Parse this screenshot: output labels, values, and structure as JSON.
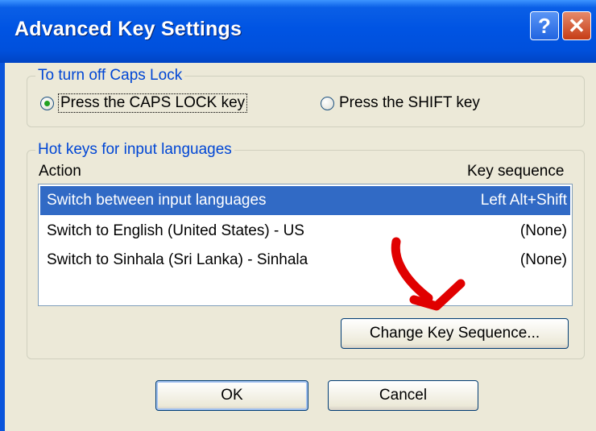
{
  "window": {
    "title": "Advanced Key Settings",
    "help_icon": "?",
    "close_icon": "✕"
  },
  "caps_lock": {
    "legend": "To turn off Caps Lock",
    "options": [
      {
        "label": "Press the CAPS LOCK key",
        "selected": true
      },
      {
        "label": "Press the SHIFT key",
        "selected": false
      }
    ]
  },
  "hotkeys": {
    "legend": "Hot keys for input languages",
    "columns": {
      "action": "Action",
      "key_sequence": "Key sequence"
    },
    "rows": [
      {
        "action": "Switch between input languages",
        "keys": "Left Alt+Shift",
        "selected": true
      },
      {
        "action": "Switch to English (United States) - US",
        "keys": "(None)",
        "selected": false
      },
      {
        "action": "Switch to Sinhala (Sri Lanka) - Sinhala",
        "keys": "(None)",
        "selected": false
      }
    ],
    "change_button": "Change Key Sequence..."
  },
  "buttons": {
    "ok": "OK",
    "cancel": "Cancel"
  },
  "annotation": {
    "arrow_color": "#e00000"
  }
}
